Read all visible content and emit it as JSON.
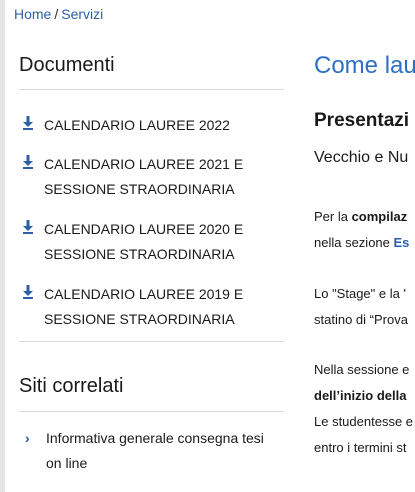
{
  "breadcrumb": {
    "home": "Home",
    "separator": "/",
    "current": "Servizi"
  },
  "documents": {
    "heading": "Documenti",
    "items": [
      {
        "line1": "CALENDARIO LAUREE 2022",
        "line2": ""
      },
      {
        "line1": "CALENDARIO LAUREE 2021 E",
        "line2": "SESSIONE STRAORDINARIA"
      },
      {
        "line1": "CALENDARIO LAUREE 2020 E",
        "line2": "SESSIONE STRAORDINARIA"
      },
      {
        "line1": "CALENDARIO LAUREE 2019 E",
        "line2": "SESSIONE STRAORDINARIA"
      }
    ]
  },
  "related": {
    "heading": "Siti correlati",
    "items": [
      {
        "line1": "Informativa generale consegna tesi",
        "line2": "on line"
      }
    ]
  },
  "main": {
    "title": "Come lau",
    "subtitle": "Presentazi",
    "lead": "Vecchio e Nu",
    "p1_a": "Per la ",
    "p1_b": "compilaz",
    "p1_line2_a": "nella sezione ",
    "p1_line2_b": "Es",
    "p2_line1": "Lo \"Stage\" e la '",
    "p2_line2": "statino di “Prova",
    "p3_line1": "Nella sessione e",
    "p3_line2": "dell’inizio della",
    "p3_line3": "Le studentesse e",
    "p3_line4": "entro i termini st"
  },
  "colors": {
    "link": "#2d5fa8",
    "title": "#2d6fc4",
    "divider": "#d9d9d9"
  },
  "icons": {
    "document": "download-icon",
    "related": "chevron-right-icon"
  }
}
